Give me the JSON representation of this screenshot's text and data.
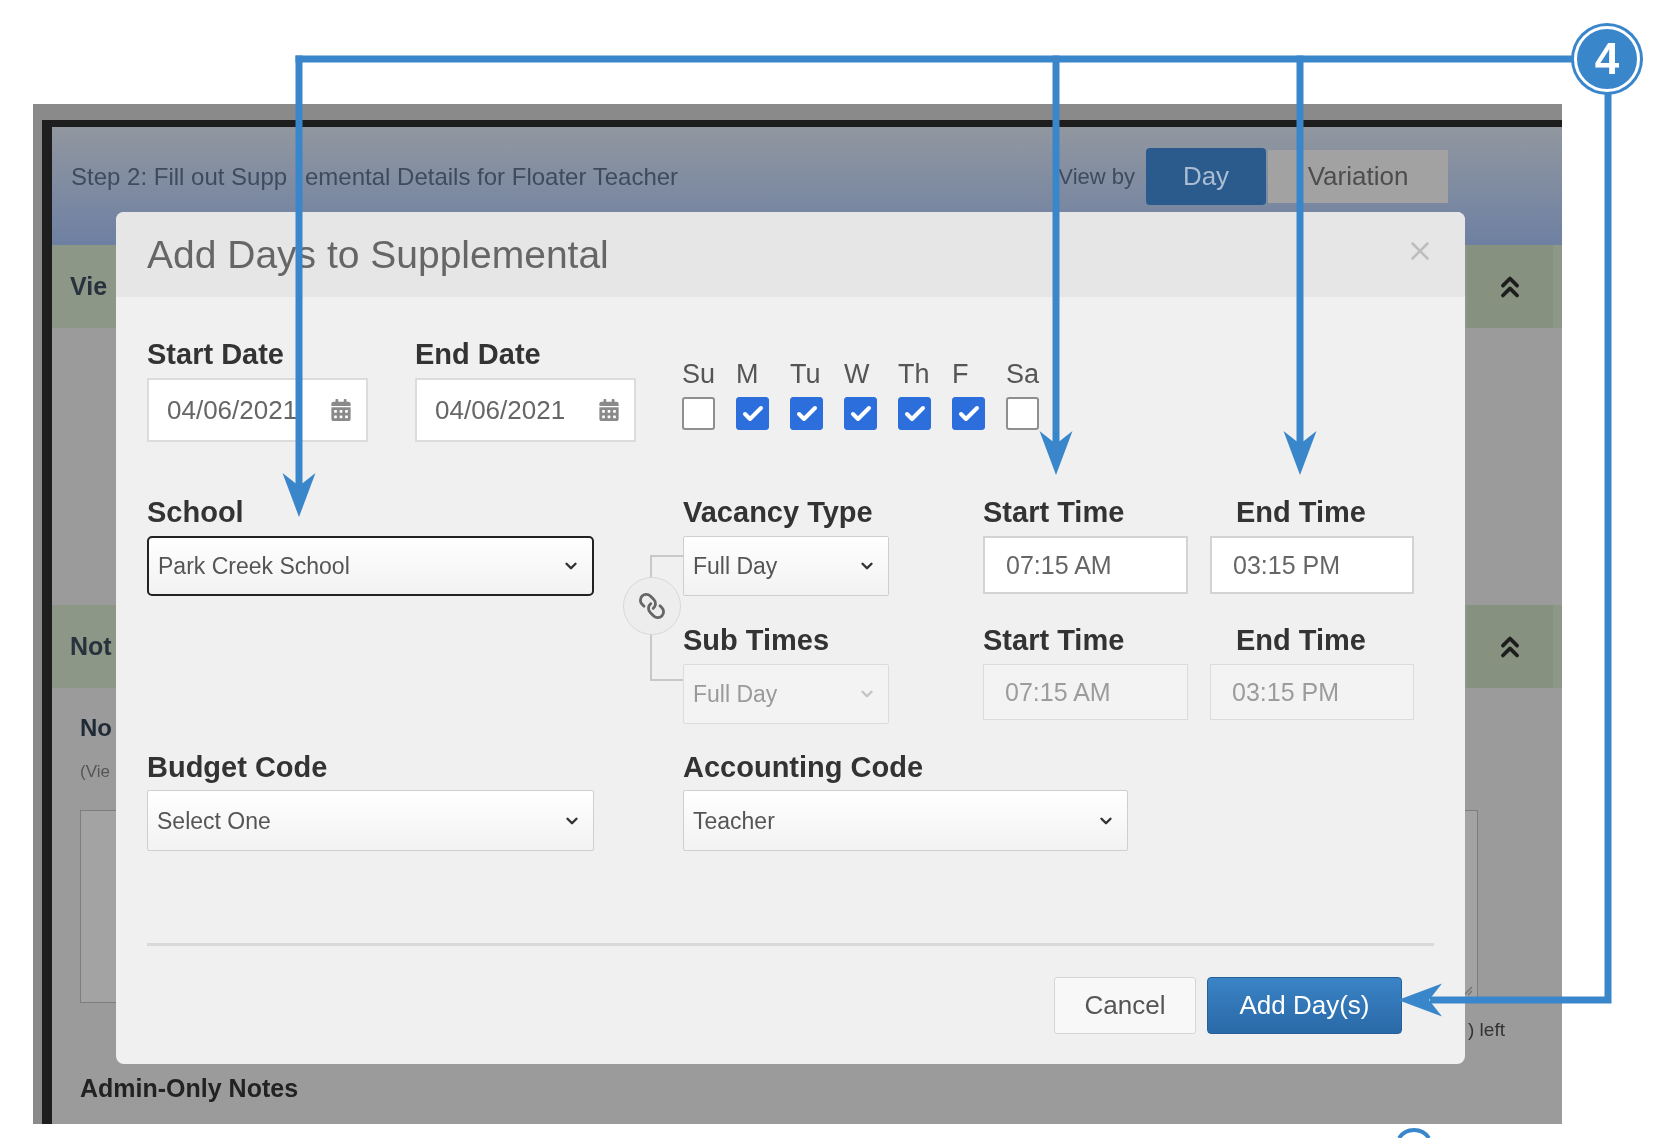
{
  "annotation": {
    "number": "4"
  },
  "page": {
    "step_title_parts": [
      "Step 2: Fill out Supp",
      "emental Details for Floater Teacher"
    ],
    "view_by_label": "View by",
    "view_options": [
      {
        "label": "Day",
        "selected": true
      },
      {
        "label": "Variation",
        "selected": false
      }
    ],
    "sections": [
      {
        "title": "Vie"
      },
      {
        "title": "Not"
      }
    ],
    "notes_label": "No",
    "notes_hint": "(Vie",
    "char_count": ") left",
    "admin_notes_label": "Admin-Only Notes"
  },
  "dialog": {
    "title": "Add Days to Supplemental",
    "dates": [
      {
        "label": "Start Date",
        "value": "04/06/2021"
      },
      {
        "label": "End Date",
        "value": "04/06/2021"
      }
    ],
    "weekdays": [
      {
        "label": "Su",
        "checked": false
      },
      {
        "label": "M",
        "checked": true
      },
      {
        "label": "Tu",
        "checked": true
      },
      {
        "label": "W",
        "checked": true
      },
      {
        "label": "Th",
        "checked": true
      },
      {
        "label": "F",
        "checked": true
      },
      {
        "label": "Sa",
        "checked": false
      }
    ],
    "school": {
      "label": "School",
      "value": "Park Creek School",
      "focused": true
    },
    "time_rows": [
      {
        "label": "Vacancy Type",
        "value": "Full Day",
        "disabled": false,
        "times": [
          {
            "label": "Start Time",
            "value": "07:15 AM"
          },
          {
            "label": "End Time",
            "value": "03:15 PM"
          }
        ]
      },
      {
        "label": "Sub Times",
        "value": "Full Day",
        "disabled": true,
        "times": [
          {
            "label": "Start Time",
            "value": "07:15 AM"
          },
          {
            "label": "End Time",
            "value": "03:15 PM"
          }
        ]
      }
    ],
    "budget_code": {
      "label": "Budget Code",
      "value": "Select One",
      "focused": false
    },
    "accounting_code": {
      "label": "Accounting Code",
      "value": "Teacher",
      "focused": false
    },
    "buttons": [
      {
        "label": "Cancel",
        "kind": "secondary"
      },
      {
        "label": "Add Day(s)",
        "kind": "primary"
      }
    ]
  }
}
